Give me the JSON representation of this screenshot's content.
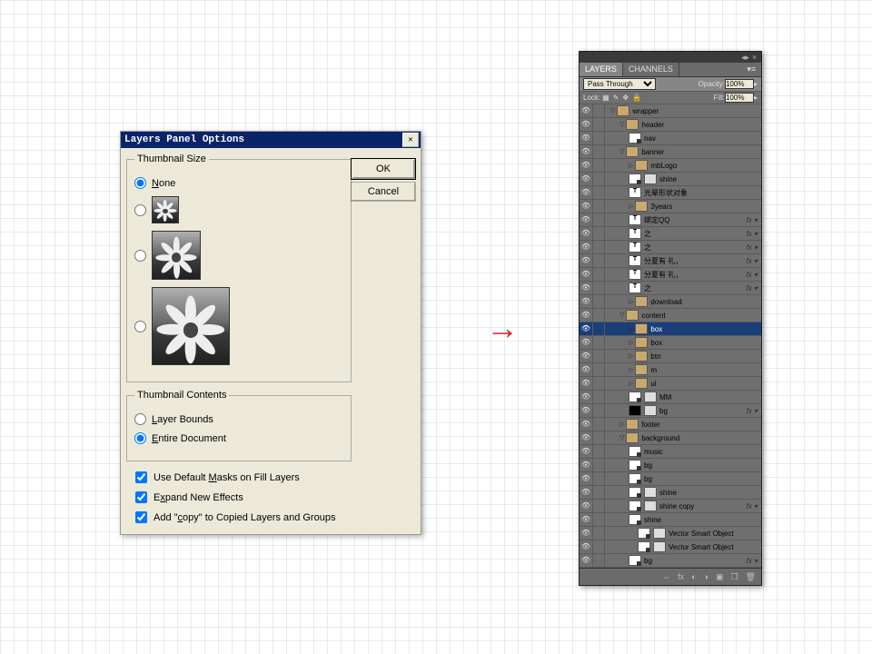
{
  "dialog": {
    "title": "Layers Panel Options",
    "thumbGroup": "Thumbnail Size",
    "none": "None",
    "contentsGroup": "Thumbnail Contents",
    "layerBounds": "Layer Bounds",
    "entireDoc": "Entire Document",
    "chk1": "Use Default Masks on Fill Layers",
    "chk2": "Expand New Effects",
    "chk3": "Add \"copy\" to Copied Layers and Groups",
    "ok": "OK",
    "cancel": "Cancel"
  },
  "panel": {
    "tabs": [
      "LAYERS",
      "CHANNELS"
    ],
    "blend": "Pass Through",
    "opacityLabel": "Opacity:",
    "opacityVal": "100%",
    "lockLabel": "Lock:",
    "fillLabel": "Fill:",
    "fillVal": "100%",
    "layers": [
      {
        "d": 0,
        "t": "grp",
        "tri": "▽",
        "n": "wrapper"
      },
      {
        "d": 1,
        "t": "grp",
        "tri": "▽",
        "n": "header"
      },
      {
        "d": 2,
        "t": "smart",
        "n": "nav"
      },
      {
        "d": 1,
        "t": "grp",
        "tri": "▽",
        "n": "banner"
      },
      {
        "d": 2,
        "t": "fold",
        "tri": "▷",
        "n": "mbLogo"
      },
      {
        "d": 2,
        "t": "smart",
        "n": "shine",
        "mask": 1
      },
      {
        "d": 2,
        "t": "txt",
        "n": "光晕形状对象"
      },
      {
        "d": 2,
        "t": "fold",
        "tri": "▷",
        "n": "3years"
      },
      {
        "d": 2,
        "t": "txt",
        "n": "绑定QQ",
        "fx": 1
      },
      {
        "d": 2,
        "t": "txt",
        "n": "之",
        "fx": 1
      },
      {
        "d": 2,
        "t": "txt",
        "n": "之",
        "fx": 1
      },
      {
        "d": 2,
        "t": "txt",
        "n": "分夏有 礼，",
        "fx": 1
      },
      {
        "d": 2,
        "t": "txt",
        "n": "分夏有 礼，",
        "fx": 1
      },
      {
        "d": 2,
        "t": "txt",
        "n": "之",
        "fx": 1
      },
      {
        "d": 2,
        "t": "fold",
        "tri": "▷",
        "n": "download"
      },
      {
        "d": 1,
        "t": "grp",
        "tri": "▽",
        "n": "content"
      },
      {
        "d": 2,
        "t": "fold",
        "tri": "▶",
        "n": "box",
        "sel": 1
      },
      {
        "d": 2,
        "t": "fold",
        "tri": "▷",
        "n": "box"
      },
      {
        "d": 2,
        "t": "fold",
        "tri": "▷",
        "n": "btn"
      },
      {
        "d": 2,
        "t": "fold",
        "tri": "▷",
        "n": "m"
      },
      {
        "d": 2,
        "t": "fold",
        "tri": "▷",
        "n": "ul"
      },
      {
        "d": 2,
        "t": "smart",
        "n": "MM",
        "mask": 1
      },
      {
        "d": 2,
        "t": "black",
        "n": "bg",
        "fx": 1,
        "mask": 1
      },
      {
        "d": 1,
        "t": "fold",
        "tri": "▷",
        "n": "footer"
      },
      {
        "d": 1,
        "t": "grp",
        "tri": "▽",
        "n": "background"
      },
      {
        "d": 2,
        "t": "smart",
        "n": "music"
      },
      {
        "d": 2,
        "t": "smart",
        "n": "bg"
      },
      {
        "d": 2,
        "t": "smart",
        "n": "bg"
      },
      {
        "d": 2,
        "t": "smart",
        "n": "shine",
        "mask": 1
      },
      {
        "d": 2,
        "t": "smart",
        "n": "shine copy",
        "mask": 1,
        "fx": 1
      },
      {
        "d": 2,
        "t": "smart",
        "n": "shine"
      },
      {
        "d": 3,
        "t": "smart",
        "n": "Vector Smart Object",
        "mask": 1
      },
      {
        "d": 3,
        "t": "smart",
        "n": "Vector Smart Object",
        "mask": 1
      },
      {
        "d": 2,
        "t": "smart",
        "n": "bg",
        "fx": 1
      }
    ]
  }
}
